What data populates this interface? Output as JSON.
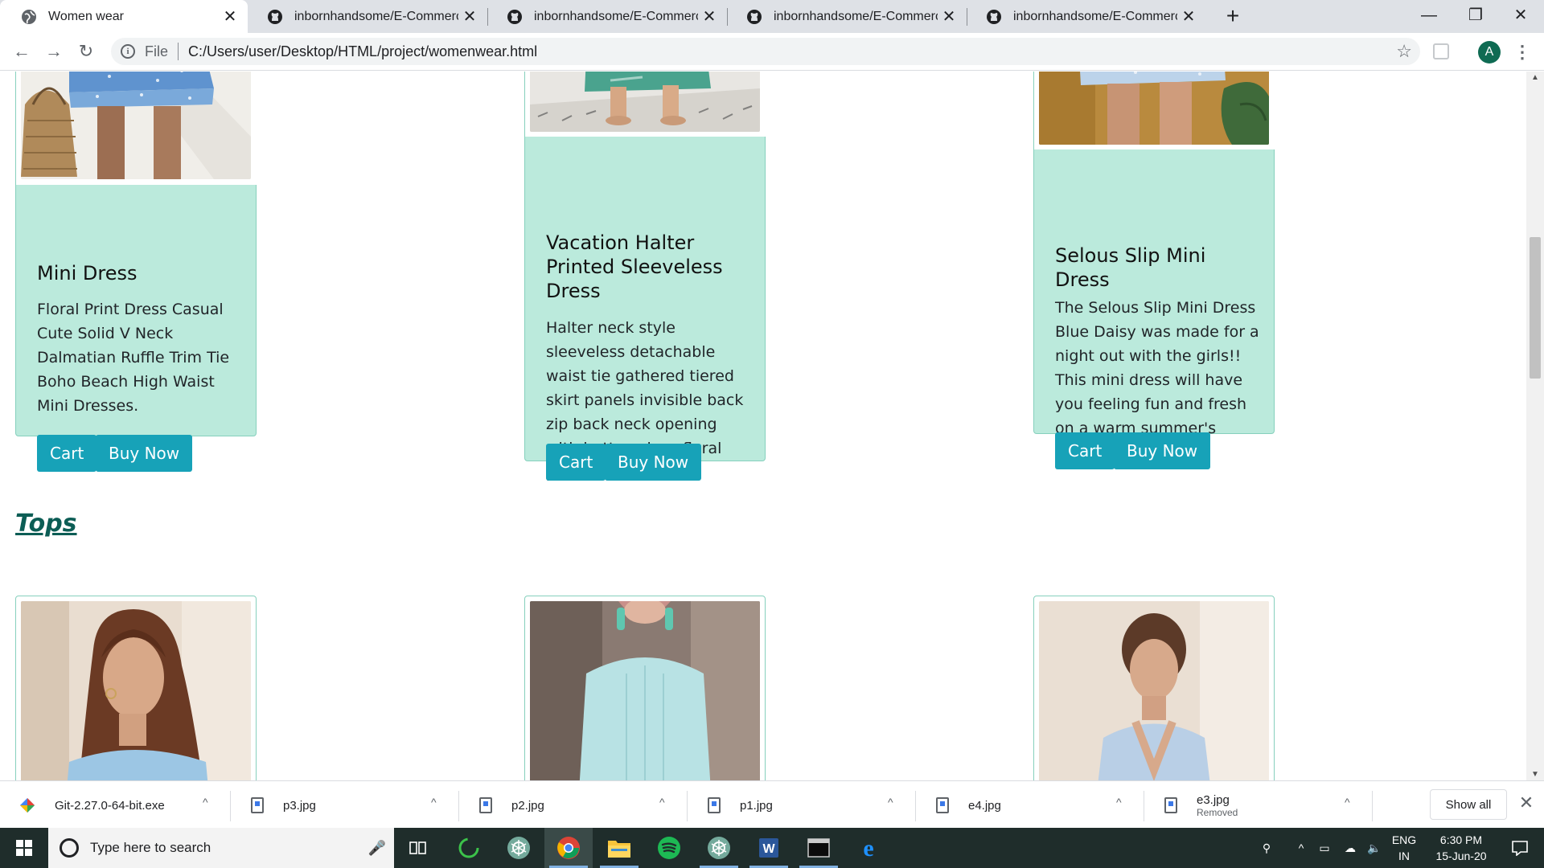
{
  "browser": {
    "tabs": [
      {
        "title": "Women wear",
        "active": true
      },
      {
        "title": "inbornhandsome/E-Commerce a"
      },
      {
        "title": "inbornhandsome/E-Commerce a"
      },
      {
        "title": "inbornhandsome/E-Commerce"
      },
      {
        "title": "inbornhandsome/E-Commerce"
      }
    ],
    "close_glyph": "✕",
    "new_tab_glyph": "+",
    "window": {
      "minimize": "—",
      "maximize": "❐",
      "close": "✕"
    },
    "nav": {
      "back": "←",
      "forward": "→",
      "reload": "↻"
    },
    "omnibox": {
      "scheme_label": "File",
      "url": "C:/Users/user/Desktop/HTML/project/womenwear.html",
      "info_icon": "i",
      "star_icon": "☆"
    },
    "profile_initial": "A",
    "menu_icon": "⋮"
  },
  "page": {
    "dresses": [
      {
        "title": "Mini Dress",
        "description": "Floral Print Dress Casual Cute Solid V Neck Dalmatian Ruffle Trim Tie Boho Beach High Waist Mini Dresses.",
        "cart_label": "Cart",
        "buy_label": "Buy Now"
      },
      {
        "title": "Vacation Halter Printed Sleeveless Dress",
        "description": "Halter neck style sleeveless detachable waist tie gathered tiered skirt panels invisible back zip back neck opening with button close floral print.",
        "cart_label": "Cart",
        "buy_label": "Buy Now"
      },
      {
        "title": "Selous Slip Mini Dress",
        "description": "The Selous Slip Mini Dress Blue Daisy was made for a night out with the girls!! This mini dress will have you feeling fun and fresh on a warm summer's night.",
        "cart_label": "Cart",
        "buy_label": "Buy Now"
      }
    ],
    "tops_heading": "Tops"
  },
  "downloads": {
    "items": [
      {
        "name": "Git-2.27.0-64-bit.exe",
        "status": ""
      },
      {
        "name": "p3.jpg",
        "status": ""
      },
      {
        "name": "p2.jpg",
        "status": ""
      },
      {
        "name": "p1.jpg",
        "status": ""
      },
      {
        "name": "e4.jpg",
        "status": ""
      },
      {
        "name": "e3.jpg",
        "status": "Removed"
      }
    ],
    "show_all_label": "Show all",
    "close_glyph": "✕",
    "caret_glyph": "^"
  },
  "taskbar": {
    "search_placeholder": "Type here to search",
    "apps": [
      "task-view",
      "circle-app",
      "chatgpt-like",
      "chrome",
      "file-explorer",
      "spotify",
      "chatgpt-like-2",
      "word",
      "terminal",
      "edge"
    ],
    "language": "ENG",
    "region": "IN",
    "time": "6:30 PM",
    "date": "15-Jun-20"
  },
  "colors": {
    "card_bg": "#bbeadc",
    "button_bg": "#17a2b8",
    "heading": "#0c5d55",
    "taskbar_bg": "#1f2d2b"
  }
}
